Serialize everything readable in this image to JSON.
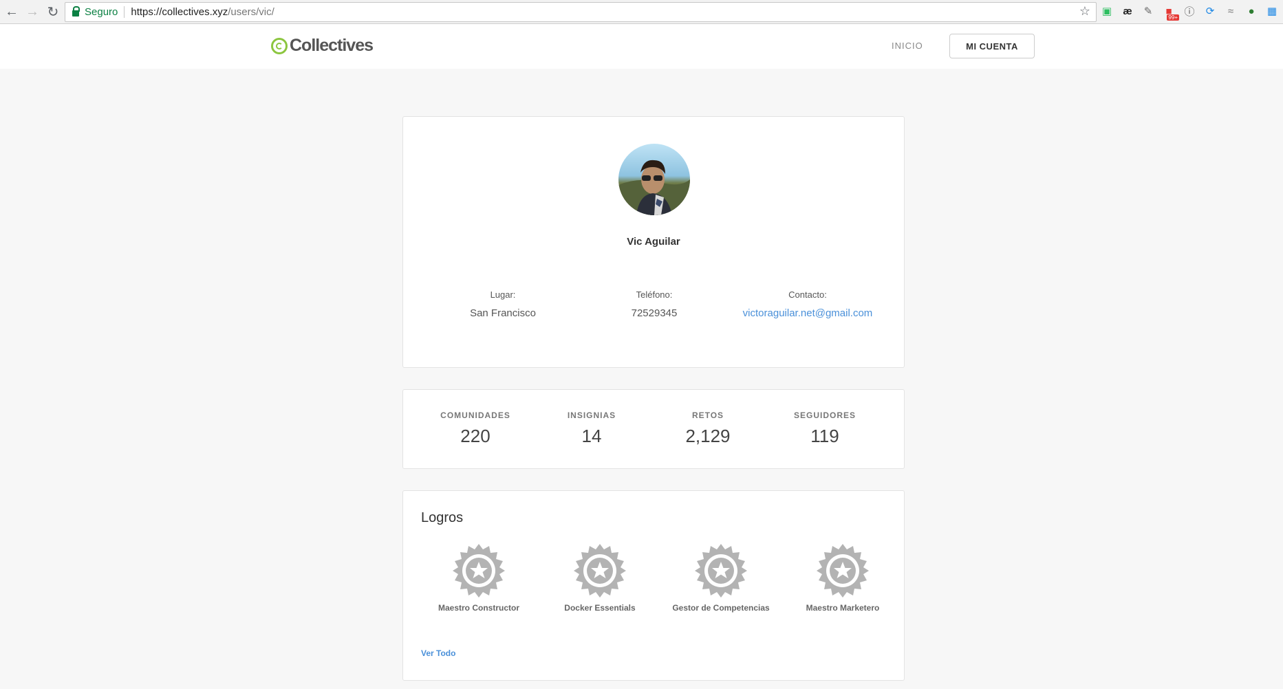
{
  "browser": {
    "secure_label": "Seguro",
    "url_host": "https://collectives.xyz",
    "url_path": "/users/vic/",
    "extension_badge": "99+"
  },
  "header": {
    "logo_text": "Collectives",
    "nav_inicio": "INICIO",
    "nav_mi_cuenta": "MI CUENTA"
  },
  "profile": {
    "name": "Vic Aguilar",
    "lugar_label": "Lugar:",
    "lugar_value": "San Francisco",
    "telefono_label": "Teléfono:",
    "telefono_value": "72529345",
    "contacto_label": "Contacto:",
    "contacto_value": "victoraguilar.net@gmail.com"
  },
  "stats": [
    {
      "label": "COMUNIDADES",
      "value": "220"
    },
    {
      "label": "INSIGNIAS",
      "value": "14"
    },
    {
      "label": "RETOS",
      "value": "2,129"
    },
    {
      "label": "SEGUIDORES",
      "value": "119"
    }
  ],
  "logros": {
    "title": "Logros",
    "badges": [
      {
        "name": "Maestro Constructor"
      },
      {
        "name": "Docker Essentials"
      },
      {
        "name": "Gestor de Competencias"
      },
      {
        "name": "Maestro Marketero"
      }
    ],
    "ver_todo": "Ver Todo"
  },
  "colors": {
    "brand_green": "#8cc63f",
    "link_blue": "#4a90d9",
    "badge_gray": "#b3b3b3"
  }
}
